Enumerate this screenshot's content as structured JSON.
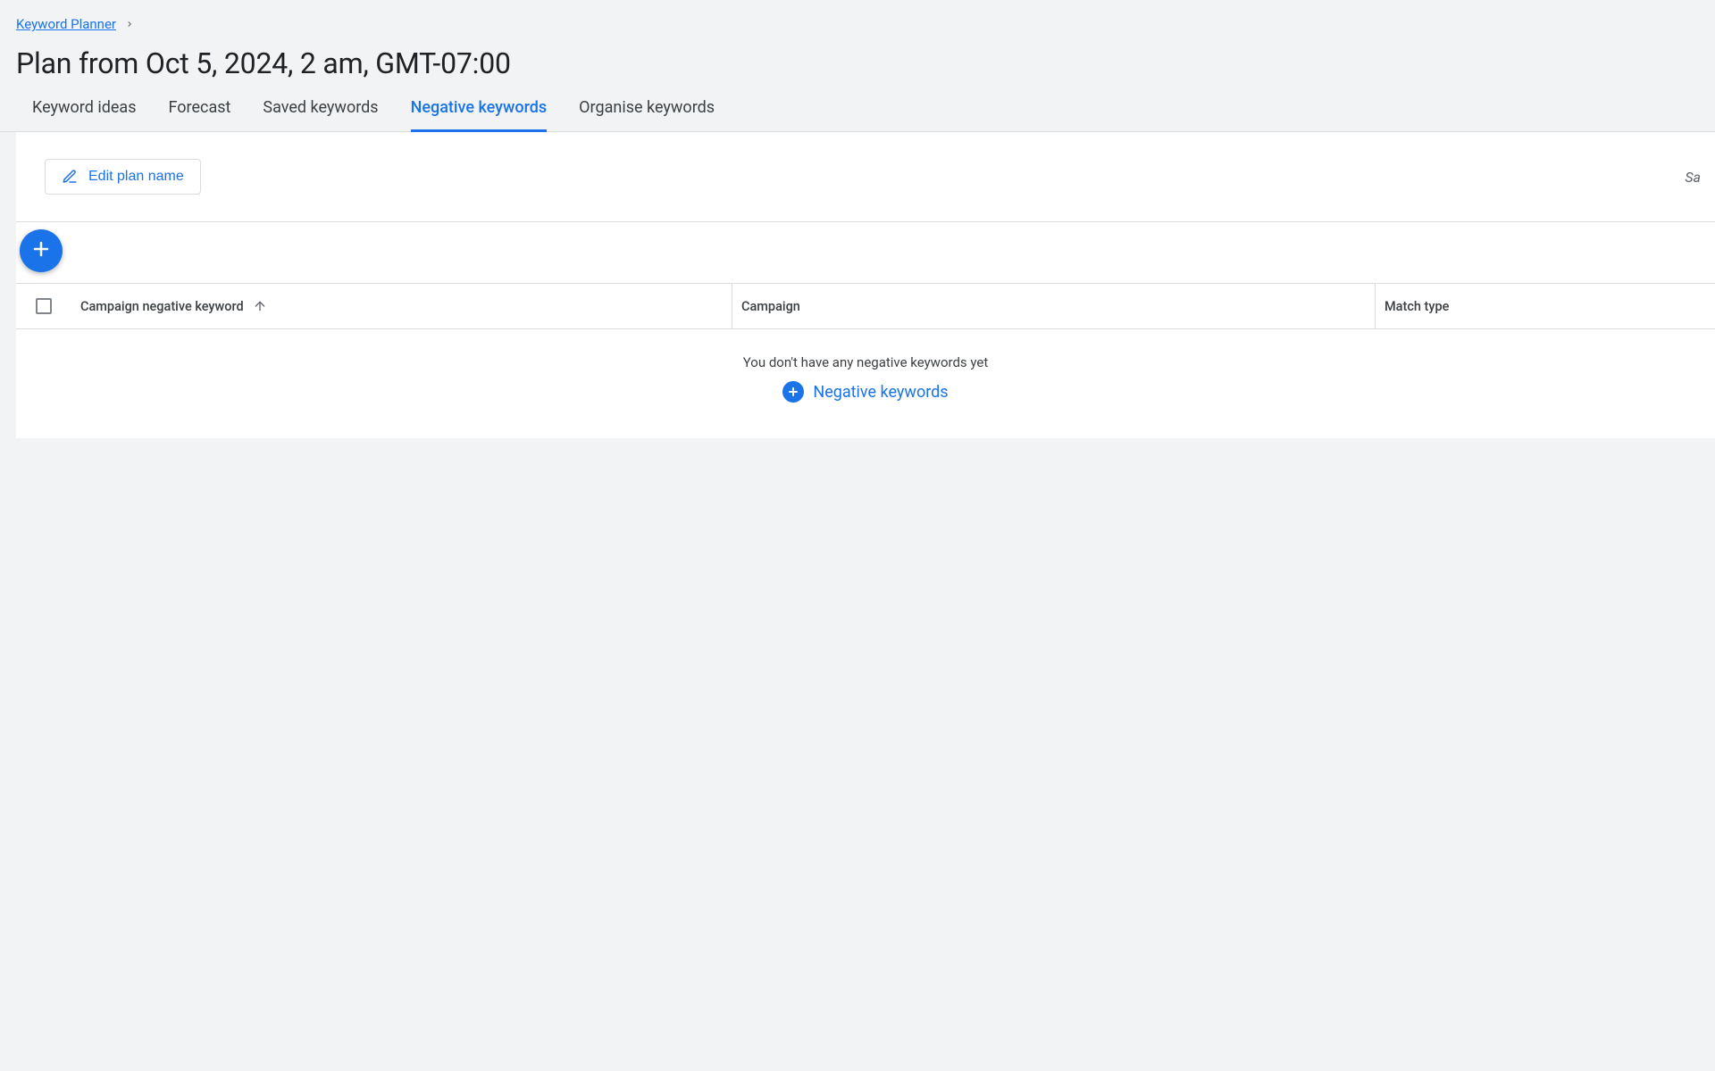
{
  "breadcrumb": {
    "parent_label": "Keyword Planner"
  },
  "page": {
    "title": "Plan from Oct 5, 2024, 2 am, GMT-07:00"
  },
  "tabs": [
    {
      "label": "Keyword ideas",
      "active": false
    },
    {
      "label": "Forecast",
      "active": false
    },
    {
      "label": "Saved keywords",
      "active": false
    },
    {
      "label": "Negative keywords",
      "active": true
    },
    {
      "label": "Organise keywords",
      "active": false
    }
  ],
  "toolbar": {
    "edit_plan_label": "Edit plan name",
    "status_partial": "Sa"
  },
  "table": {
    "columns": {
      "keyword": "Campaign negative keyword",
      "campaign": "Campaign",
      "match_type": "Match type"
    },
    "sort": {
      "column": "keyword",
      "direction": "asc"
    },
    "rows": []
  },
  "empty_state": {
    "message": "You don't have any negative keywords yet",
    "action_label": "Negative keywords"
  },
  "colors": {
    "accent": "#1a73e8",
    "bg": "#f1f3f4",
    "border": "#dadce0"
  }
}
